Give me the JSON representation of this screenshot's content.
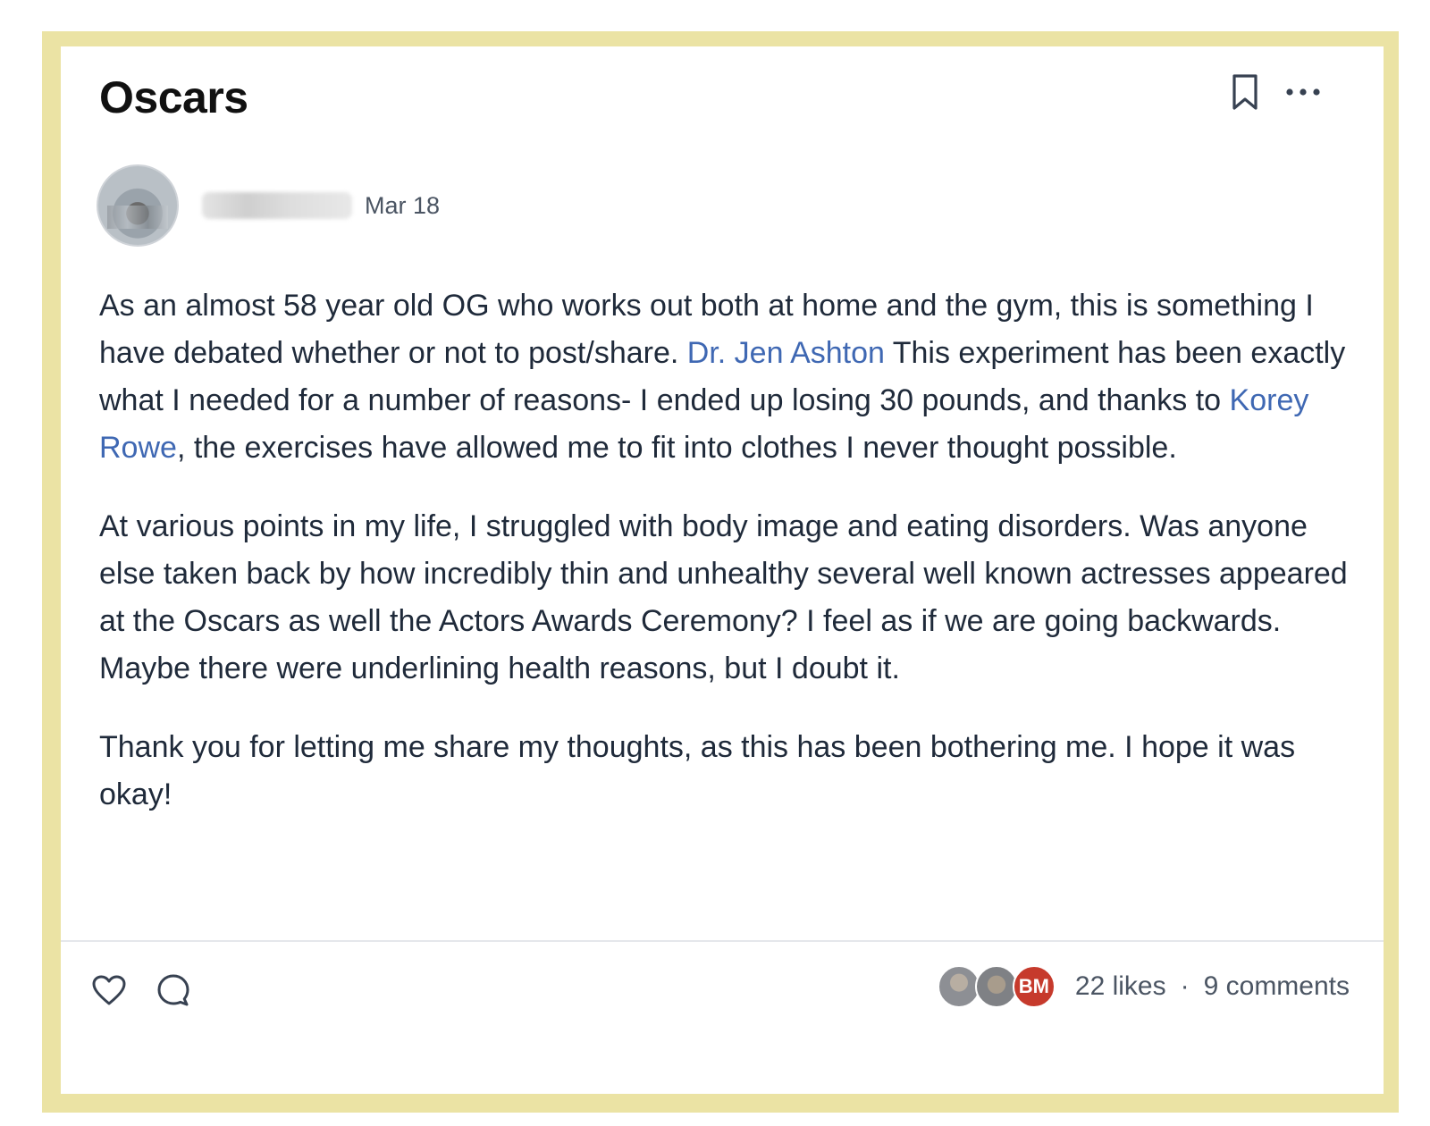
{
  "post": {
    "title": "Oscars",
    "author": {
      "name": "",
      "avatar_icon": "user-photo-avatar"
    },
    "date": "Mar 18",
    "mentions": [
      "Dr. Jen Ashton",
      "Korey Rowe"
    ],
    "paragraph1": {
      "part1": " As an almost 58 year old OG who works out both at home and the gym, this is something I have debated whether or not to post/share. ",
      "mention1": "Dr. Jen Ashton",
      "part2": " This experiment has been exactly what I needed for a number of reasons- I ended up losing 30 pounds, and thanks to ",
      "mention2": "Korey Rowe",
      "part3": ", the exercises have allowed me to fit into clothes I never thought possible."
    },
    "paragraph2": "At various points in my life, I struggled with body image and eating disorders. Was anyone else taken back by how incredibly thin and unhealthy several well known actresses appeared at the Oscars as well the Actors Awards Ceremony? I feel as if we are going backwards.  Maybe there were underlining health reasons, but I doubt it.",
    "paragraph3": "Thank you for letting me share my thoughts, as this has been bothering me. I hope it was okay!"
  },
  "header_actions": {
    "bookmark_icon": "bookmark-icon",
    "more_icon": "more-horizontal-icon"
  },
  "footer": {
    "like_icon": "heart-icon",
    "comment_icon": "comment-icon",
    "likers": [
      {
        "initials": "",
        "kind": "photo"
      },
      {
        "initials": "",
        "kind": "photo"
      },
      {
        "initials": "BM",
        "kind": "initials"
      }
    ],
    "likes_label": "22 likes",
    "separator": "·",
    "comments_label": "9 comments"
  },
  "colors": {
    "frame": "#ebe3a4",
    "mention": "#3f68b3",
    "liker_bm": "#c63a2c"
  }
}
